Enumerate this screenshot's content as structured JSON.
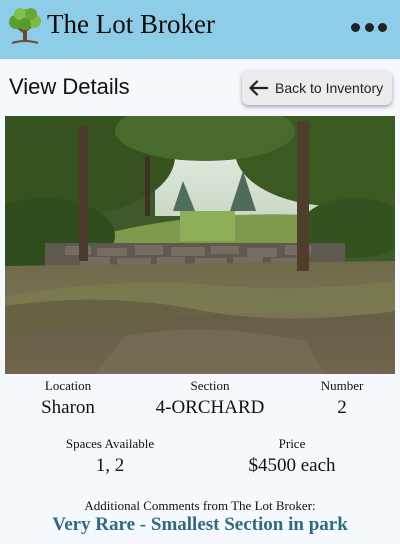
{
  "header": {
    "brand": "The Lot Broker",
    "logo_icon": "tree-icon",
    "menu_icon": "more-horizontal-icon",
    "background_color": "#8ecde8"
  },
  "page": {
    "title": "View Details",
    "back_button_label": "Back to Inventory",
    "back_icon": "arrow-left-icon"
  },
  "details": {
    "location_label": "Location",
    "location_value": "Sharon",
    "section_label": "Section",
    "section_value": "4-ORCHARD",
    "number_label": "Number",
    "number_value": "2",
    "spaces_label": "Spaces Available",
    "spaces_value": "1, 2",
    "price_label": "Price",
    "price_value": "$4500 each"
  },
  "comments": {
    "label": "Additional Comments from The Lot Broker:",
    "text": "Very Rare - Smallest Section in park",
    "color": "#2e6b82"
  }
}
